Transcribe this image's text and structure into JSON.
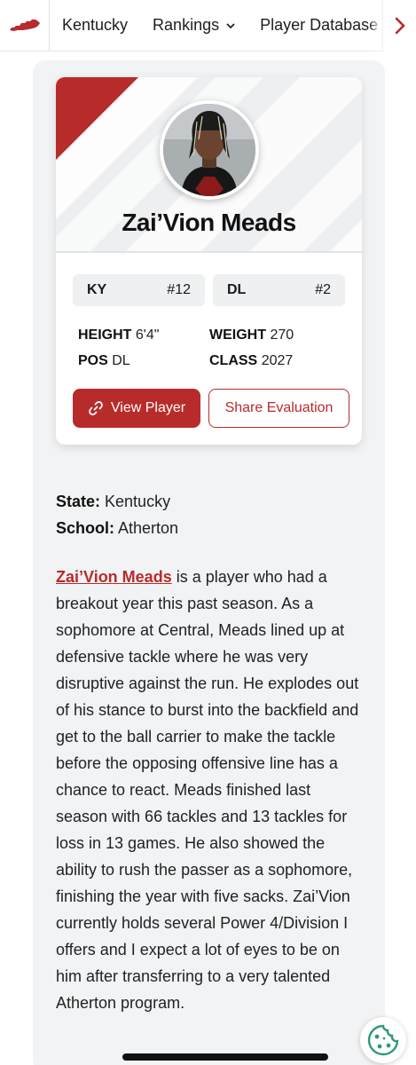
{
  "nav": {
    "items": [
      "Kentucky",
      "Rankings",
      "Player Database"
    ]
  },
  "player": {
    "name": "Zai’Vion Meads",
    "state_abbr": "KY",
    "state_rank": "#12",
    "position_label": "DL",
    "position_rank": "#2",
    "height_label": "HEIGHT",
    "height": "6'4\"",
    "weight_label": "WEIGHT",
    "weight": "270",
    "pos_label": "POS",
    "pos": "DL",
    "class_label": "CLASS",
    "class_year": "2027"
  },
  "buttons": {
    "view_player": "View Player",
    "share_evaluation": "Share Evaluation"
  },
  "details": {
    "state_label": "State:",
    "state": "Kentucky",
    "school_label": "School:",
    "school": "Atherton"
  },
  "article": {
    "link_name": "Zai’Vion Meads",
    "body": " is a player who had a breakout year this past season. As a sophomore at Central, Meads lined up at defensive tackle where he was very disruptive against the run. He explodes out of his stance to burst into the backfield and get to the ball carrier to make the tackle before the opposing offensive line has a chance to react. Meads finished last season with 66 tackles and 13 tackles for loss in 13 games. He also showed the ability to rush the passer as a sophomore, finishing the year with five sacks. Zai’Vion currently holds several Power 4/Division I offers and I expect a lot of eyes to be on him after transferring to a very talented Atherton program."
  },
  "colors": {
    "accent": "#b72b2b",
    "panel": "#f2f3f5",
    "cookie": "#2f9a78"
  },
  "icons": {
    "logo": "kentucky-state-icon",
    "rankings_dropdown": "chevron-down-icon",
    "nav_scroll": "chevron-right-icon",
    "view_player": "link-icon",
    "cookie": "cookie-icon"
  }
}
